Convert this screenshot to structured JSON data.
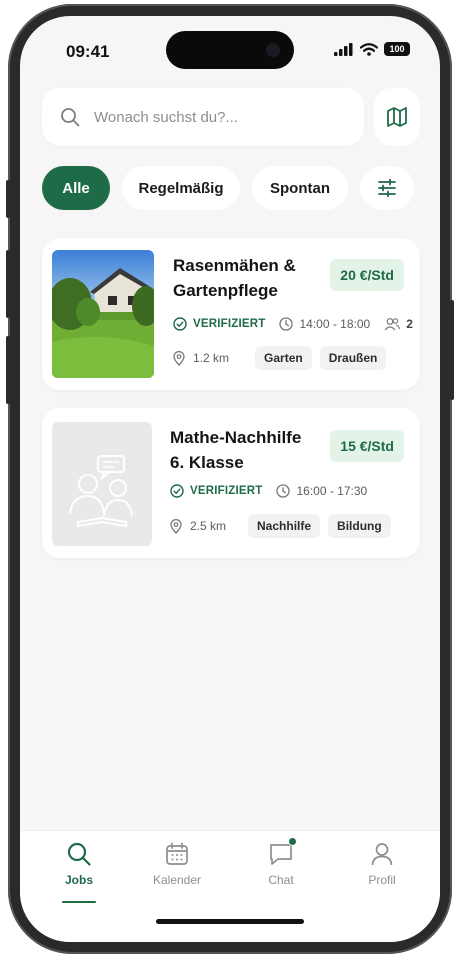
{
  "status_bar": {
    "time": "09:41",
    "battery": "100"
  },
  "search": {
    "placeholder": "Wonach suchst du?..."
  },
  "filters": [
    {
      "label": "Alle",
      "active": true
    },
    {
      "label": "Regelmäßig",
      "active": false
    },
    {
      "label": "Spontan",
      "active": false
    }
  ],
  "jobs": [
    {
      "title_line1": "Rasenmähen &",
      "title_line2": "Gartenpflege",
      "price": "20 €/Std",
      "verified": "VERIFIZIERT",
      "time": "14:00 - 18:00",
      "people": "2",
      "distance": "1.2 km",
      "tags": [
        "Garten",
        "Draußen"
      ],
      "image": "garden-house-photo"
    },
    {
      "title_line1": "Mathe-Nachhilfe",
      "title_line2": "6. Klasse",
      "price": "15 €/Std",
      "verified": "VERIFIZIERT",
      "time": "16:00 - 17:30",
      "distance": "2.5 km",
      "tags": [
        "Nachhilfe",
        "Bildung"
      ],
      "image": "tutoring-placeholder-illustration"
    }
  ],
  "tabs": [
    {
      "label": "Jobs",
      "icon": "search-icon",
      "active": true
    },
    {
      "label": "Kalender",
      "icon": "calendar-icon",
      "active": false
    },
    {
      "label": "Chat",
      "icon": "chat-icon",
      "active": false,
      "badge": true
    },
    {
      "label": "Profil",
      "icon": "profile-icon",
      "active": false
    }
  ],
  "colors": {
    "accent": "#1e6b47",
    "price_bg": "#e3f3e7",
    "background": "#f5f6f5"
  }
}
